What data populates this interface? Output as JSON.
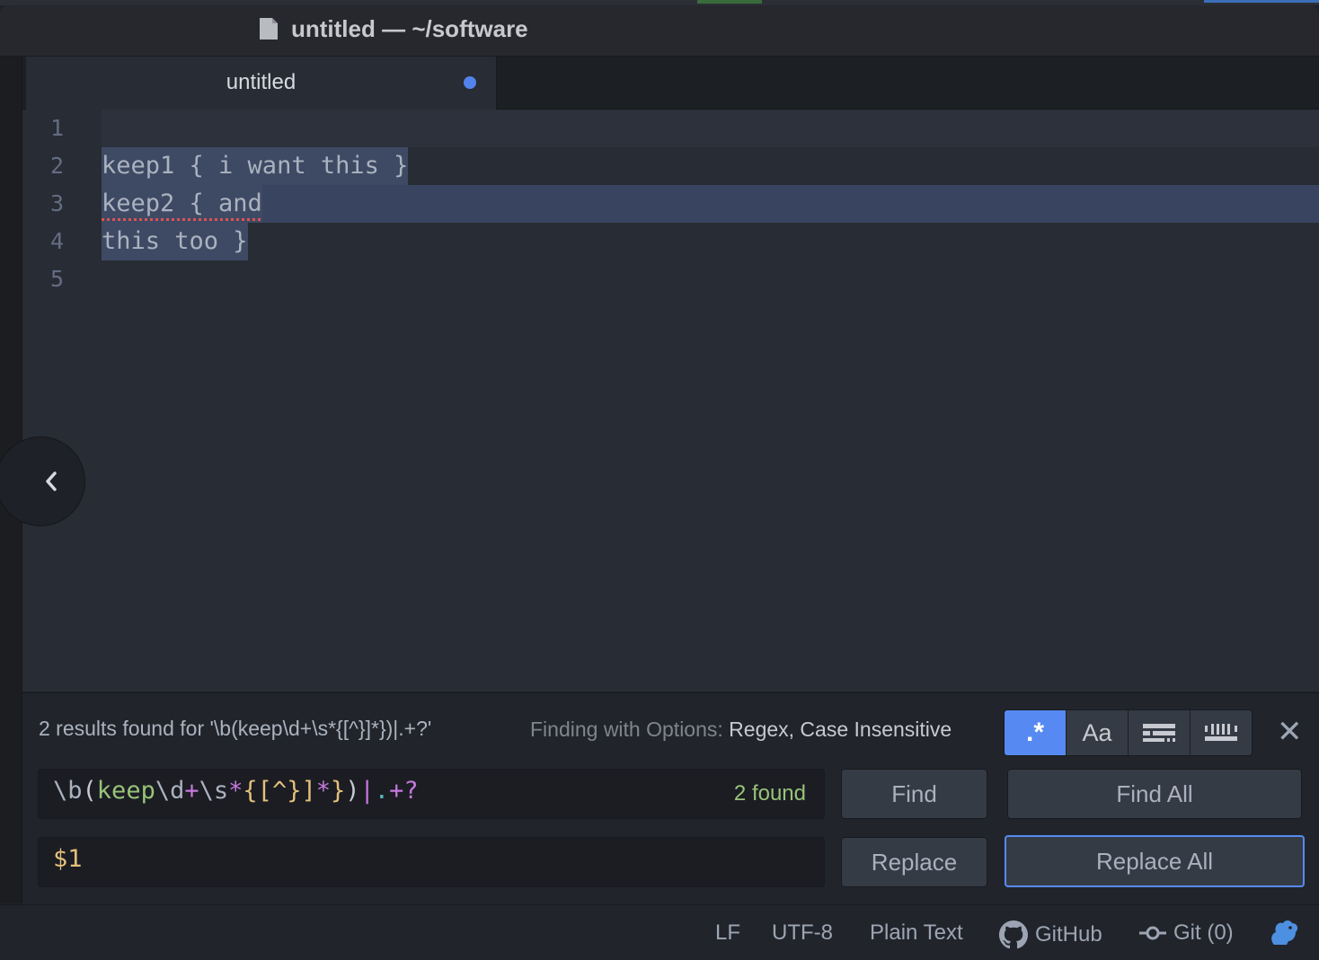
{
  "window": {
    "title": "untitled — ~/software",
    "title_icon": "document-icon"
  },
  "tabs": [
    {
      "label": "untitled",
      "modified": true
    }
  ],
  "editor": {
    "line_numbers": [
      "1",
      "2",
      "3",
      "4",
      "5"
    ],
    "lines": [
      "",
      "keep1 { i want this }",
      "keep2 { and",
      "this too }",
      ""
    ]
  },
  "find_panel": {
    "results_text": "2 results found for '\\b(keep\\d+\\s*{[^}]*})|.+?'",
    "options_label": "Finding with Options:",
    "options_value": "Regex, Case Insensitive",
    "option_buttons": [
      {
        "name": "regex",
        "label": ".*",
        "active": true
      },
      {
        "name": "case-sensitive",
        "label": "Aa",
        "active": false
      },
      {
        "name": "in-selection",
        "label": "",
        "active": false
      },
      {
        "name": "whole-word",
        "label": "",
        "active": false
      }
    ],
    "close_label": "✕",
    "find_query": "\\b(keep\\d+\\s*{[^}]*})|.+?",
    "find_count": "2 found",
    "replace_value": "$1",
    "buttons": {
      "find": "Find",
      "find_all": "Find All",
      "replace": "Replace",
      "replace_all": "Replace All"
    }
  },
  "status_bar": {
    "line_ending": "LF",
    "encoding": "UTF-8",
    "grammar": "Plain Text",
    "github": "GitHub",
    "git": "Git (0)"
  },
  "colors": {
    "accent": "#568af2",
    "editor_bg": "#282c34",
    "selection": "#3e4a64",
    "found": "#98c379"
  }
}
